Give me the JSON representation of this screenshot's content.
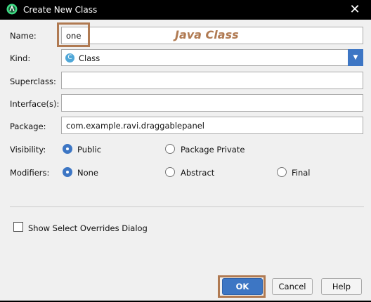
{
  "window": {
    "title": "Create New Class",
    "close_symbol": "✕"
  },
  "annotation": {
    "text": "Java Class",
    "color": "#b07a52"
  },
  "fields": {
    "name": {
      "label": "Name:",
      "value": "one"
    },
    "kind": {
      "label": "Kind:",
      "value": "Class",
      "icon_letter": "C"
    },
    "superclass": {
      "label": "Superclass:",
      "value": ""
    },
    "interfaces": {
      "label": "Interface(s):",
      "value": ""
    },
    "package": {
      "label": "Package:",
      "value": "com.example.ravi.draggablepanel"
    }
  },
  "visibility": {
    "label": "Visibility:",
    "options": [
      {
        "label": "Public",
        "selected": true
      },
      {
        "label": "Package Private",
        "selected": false
      }
    ]
  },
  "modifiers": {
    "label": "Modifiers:",
    "options": [
      {
        "label": "None",
        "selected": true
      },
      {
        "label": "Abstract",
        "selected": false
      },
      {
        "label": "Final",
        "selected": false
      }
    ]
  },
  "overrides_checkbox": {
    "label": "Show Select Overrides Dialog",
    "checked": false
  },
  "buttons": {
    "ok": "OK",
    "cancel": "Cancel",
    "help": "Help"
  },
  "colors": {
    "accent": "#3d76c4",
    "highlight": "#b07a52",
    "titlebar": "#000000"
  }
}
